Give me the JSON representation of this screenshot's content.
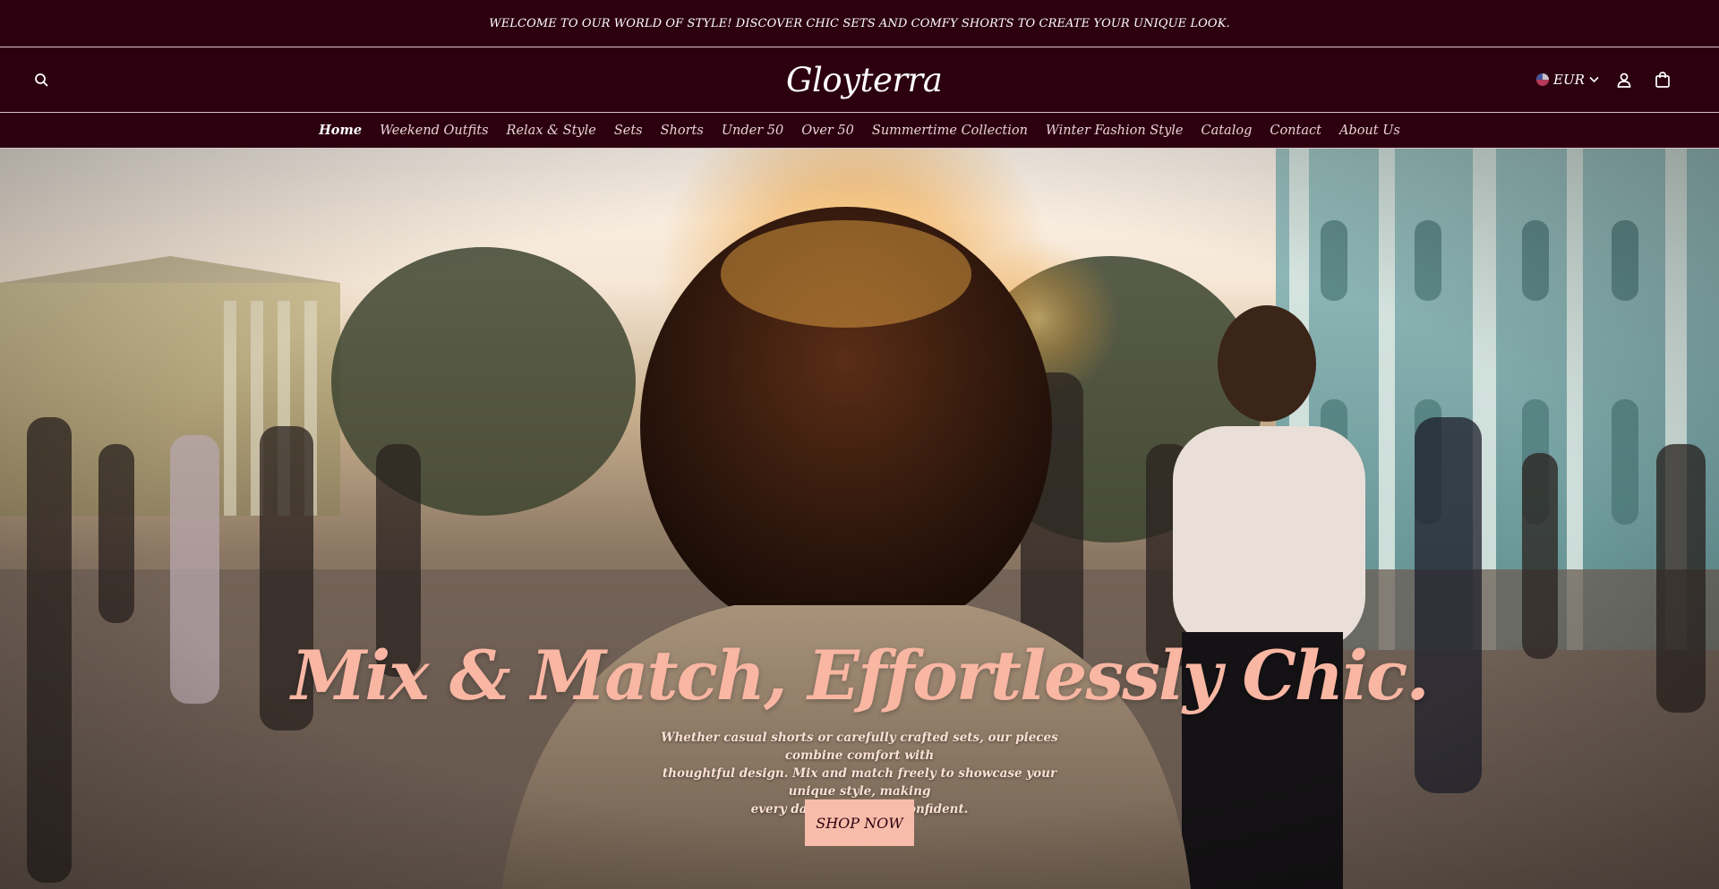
{
  "announcement": {
    "text": "WELCOME TO OUR WORLD OF STYLE! DISCOVER CHIC SETS AND COMFY SHORTS TO CREATE YOUR UNIQUE LOOK."
  },
  "header": {
    "logo_text": "Gloyterra",
    "currency": {
      "selected": "EUR",
      "flag_icon": "us-flag-icon"
    },
    "icons": [
      "search-icon",
      "account-icon",
      "cart-icon",
      "chevron-down-icon"
    ]
  },
  "nav": {
    "items": [
      {
        "label": "Home",
        "active": true
      },
      {
        "label": "Weekend Outfits"
      },
      {
        "label": "Relax & Style"
      },
      {
        "label": "Sets"
      },
      {
        "label": "Shorts"
      },
      {
        "label": "Under 50"
      },
      {
        "label": "Over 50"
      },
      {
        "label": "Summertime Collection"
      },
      {
        "label": "Winter Fashion Style"
      },
      {
        "label": "Catalog"
      },
      {
        "label": "Contact"
      },
      {
        "label": "About Us"
      }
    ]
  },
  "hero": {
    "title": "Mix & Match, Effortlessly Chic.",
    "subtitle_lines": [
      "Whether casual shorts or carefully crafted sets, our pieces combine comfort with",
      "thoughtful design. Mix and match freely to showcase your unique style, making",
      "every day vibrant and confident."
    ],
    "cta_label": "SHOP NOW"
  },
  "colors": {
    "brand_dark": "#2c000f",
    "accent_peach": "#f8bcaa",
    "title_pink": "#f8b6a3"
  }
}
